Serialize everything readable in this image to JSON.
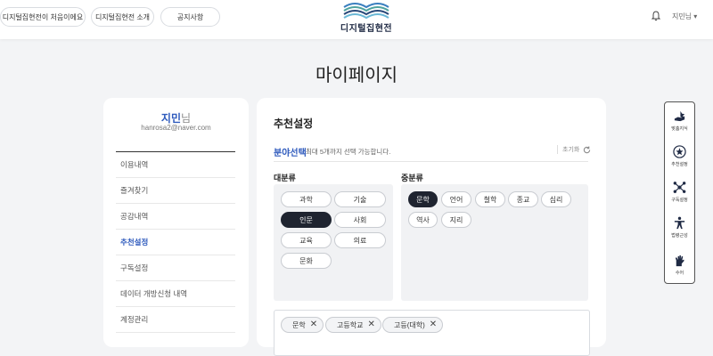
{
  "header": {
    "nav": [
      "디지털집현전이 처음이에요",
      "디지털집현전 소개",
      "공지사항"
    ],
    "logo_text": "디지털집현전",
    "user_label": "지민님 ▾"
  },
  "page_title": "마이페이지",
  "sidebar": {
    "name": "지민",
    "name_suffix": "님",
    "email": "hanrosa2@naver.com",
    "items": [
      {
        "label": "이용내역"
      },
      {
        "label": "즐겨찾기"
      },
      {
        "label": "공감내역"
      },
      {
        "label": "추천설정",
        "active": true
      },
      {
        "label": "구독설정"
      },
      {
        "label": "데이터 개방신청 내역"
      },
      {
        "label": "계정관리"
      }
    ]
  },
  "main": {
    "title": "추천설정",
    "field_label": "분야선택",
    "field_hint": "최대 5개까지 선택 가능합니다.",
    "reset_label": "초기화",
    "major_label": "대분류",
    "minor_label": "중분류",
    "major": [
      {
        "label": "과학",
        "selected": false
      },
      {
        "label": "기술",
        "selected": false
      },
      {
        "label": "인문",
        "selected": true
      },
      {
        "label": "사회",
        "selected": false
      },
      {
        "label": "교육",
        "selected": false
      },
      {
        "label": "의료",
        "selected": false
      },
      {
        "label": "문화",
        "selected": false
      }
    ],
    "minor": [
      {
        "label": "문학",
        "selected": true
      },
      {
        "label": "언어",
        "selected": false
      },
      {
        "label": "철학",
        "selected": false
      },
      {
        "label": "종교",
        "selected": false
      },
      {
        "label": "심리",
        "selected": false
      },
      {
        "label": "역사",
        "selected": false
      },
      {
        "label": "지리",
        "selected": false
      }
    ],
    "selected_tags": [
      "문학",
      "고등학교",
      "고등(대학)"
    ]
  },
  "quick_menu": [
    {
      "label": "맞춤지식",
      "icon": "hand-knowledge-icon"
    },
    {
      "label": "추천설정",
      "icon": "star-circle-icon"
    },
    {
      "label": "구독설정",
      "icon": "network-icon"
    },
    {
      "label": "법령근성",
      "icon": "accessibility-icon"
    },
    {
      "label": "수어",
      "icon": "sign-language-icon"
    }
  ]
}
